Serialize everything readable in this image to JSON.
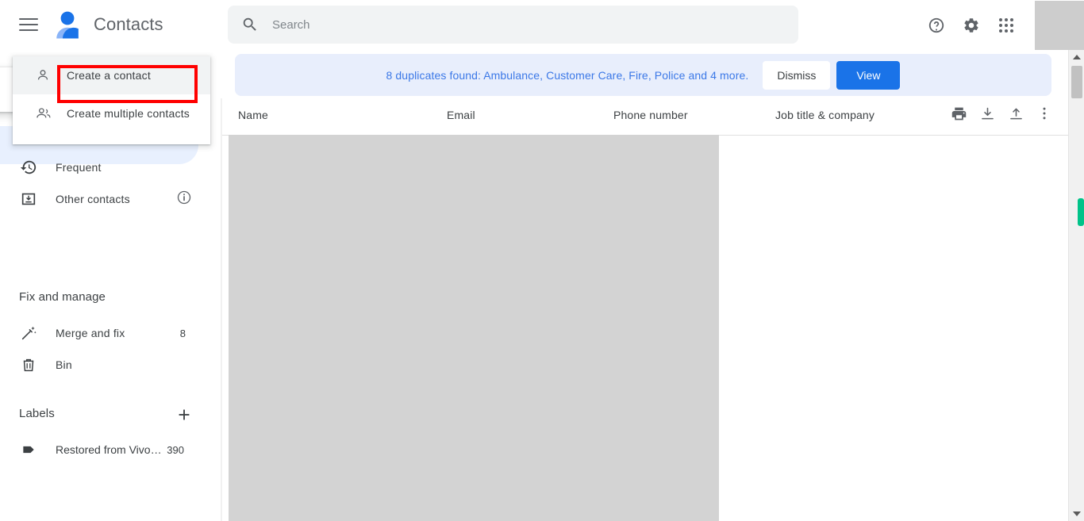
{
  "app": {
    "title": "Contacts",
    "logo_icon": "contacts-person-logo",
    "logo_color": "#1a73e8",
    "logo_color_light": "#8ab4f8"
  },
  "topbar": {
    "menu_icon": "hamburger-menu-icon",
    "search": {
      "icon": "search-icon",
      "placeholder": "Search",
      "value": ""
    },
    "actions": [
      {
        "name": "help-icon",
        "label": "Help"
      },
      {
        "name": "gear-icon",
        "label": "Settings"
      },
      {
        "name": "apps-grid-icon",
        "label": "Google apps"
      }
    ],
    "avatar": {
      "name": "avatar",
      "label": ""
    }
  },
  "menu": {
    "items": [
      {
        "label": "Create a contact",
        "icon": "person-add-icon",
        "active": true,
        "highlighted": true
      },
      {
        "label": "Create multiple contacts",
        "icon": "group-add-icon",
        "active": false,
        "highlighted": false
      }
    ],
    "highlight_color": "#ff0000"
  },
  "sidebar": {
    "nav": [
      {
        "label": "Frequent",
        "icon": "history-clock-icon",
        "count": "",
        "info": false
      },
      {
        "label": "Other contacts",
        "icon": "archive-box-icon",
        "count": "",
        "info": true
      }
    ],
    "fix_section": {
      "heading": "Fix and manage",
      "items": [
        {
          "label": "Merge and fix",
          "icon": "magic-wand-icon",
          "count": "8"
        },
        {
          "label": "Bin",
          "icon": "trash-bin-icon",
          "count": ""
        }
      ]
    },
    "labels_section": {
      "heading": "Labels",
      "add_icon": "plus-icon",
      "items": [
        {
          "label": "Restored from Vivo…",
          "icon": "label-tag-icon",
          "count": "390"
        }
      ]
    }
  },
  "banner": {
    "message": "8 duplicates found: Ambulance, Customer Care, Fire, Police and 4 more.",
    "dismiss_label": "Dismiss",
    "view_label": "View",
    "bg_color": "#e8eefc",
    "text_color": "#3b78e7",
    "primary_color": "#1a73e8"
  },
  "table": {
    "columns": [
      {
        "label": "Name"
      },
      {
        "label": "Email"
      },
      {
        "label": "Phone number"
      },
      {
        "label": "Job title & company"
      }
    ],
    "tools": [
      {
        "name": "print-icon",
        "label": "Print"
      },
      {
        "name": "download-icon",
        "label": "Export"
      },
      {
        "name": "upload-icon",
        "label": "Import"
      },
      {
        "name": "more-vertical-icon",
        "label": "More options"
      }
    ],
    "rows": []
  },
  "scrollbar": {
    "up_icon": "scroll-up-arrow-icon",
    "down_icon": "scroll-down-arrow-icon",
    "marker_color": "#00c389"
  }
}
